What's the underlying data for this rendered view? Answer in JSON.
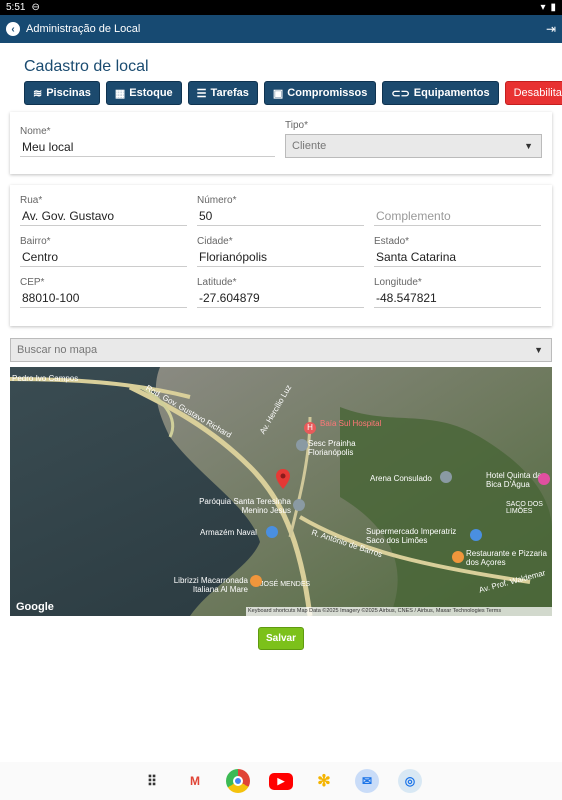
{
  "statusbar": {
    "time": "5:51"
  },
  "appbar": {
    "title": "Administração de Local"
  },
  "page": {
    "title": "Cadastro de local"
  },
  "nav": {
    "piscinas": "Piscinas",
    "estoque": "Estoque",
    "tarefas": "Tarefas",
    "compromissos": "Compromissos",
    "equipamentos": "Equipamentos",
    "desabilitar": "Desabilitar"
  },
  "form": {
    "nome_label": "Nome*",
    "nome_value": "Meu local",
    "tipo_label": "Tipo*",
    "tipo_value": "Cliente",
    "rua_label": "Rua*",
    "rua_value": "Av. Gov. Gustavo",
    "numero_label": "Número*",
    "numero_value": "50",
    "complemento_placeholder": "Complemento",
    "bairro_label": "Bairro*",
    "bairro_value": "Centro",
    "cidade_label": "Cidade*",
    "cidade_value": "Florianópolis",
    "estado_label": "Estado*",
    "estado_value": "Santa Catarina",
    "cep_label": "CEP*",
    "cep_value": "88010-100",
    "latitude_label": "Latitude*",
    "latitude_value": "-27.604879",
    "longitude_label": "Longitude*",
    "longitude_value": "-48.547821"
  },
  "map": {
    "search_placeholder": "Buscar no mapa",
    "labels": {
      "pedro_ivo": "Pedro Ivo Campos",
      "rod_gov": "Rod. Gov. Gustavo Richard",
      "av_hercilio": "Av. Hercílio Luz",
      "hospital": "Baía Sul Hospital",
      "sesc": "Sesc Prainha Florianópolis",
      "arena": "Arena Consulado",
      "hotel": "Hotel Quinta da Bica D'Água",
      "paroquia": "Paróquia Santa Teresinha Menino Jesus",
      "armazem": "Armazém Naval",
      "supermercado": "Supermercado Imperatriz Saco dos Limões",
      "restaurante": "Restaurante e Pizzaria dos Açores",
      "jose_mendes": "JOSÉ MENDES",
      "librizzi": "Librizzi Macarronada Italiana Al Mare",
      "saco": "SACO DOS LIMÕES",
      "av_antonio": "R. Antônio de Barros",
      "av_waldemar": "Av. Prof. Waldemar",
      "google": "Google",
      "attribution": "Keyboard shortcuts  Map Data ©2025 Imagery ©2025 Airbus, CNES / Airbus, Maxar Technologies  Terms"
    }
  },
  "actions": {
    "save": "Salvar"
  },
  "colors": {
    "appbar": "#174a72",
    "nav_button": "#1c4a6e",
    "danger": "#e83232",
    "save": "#7cc11a"
  }
}
